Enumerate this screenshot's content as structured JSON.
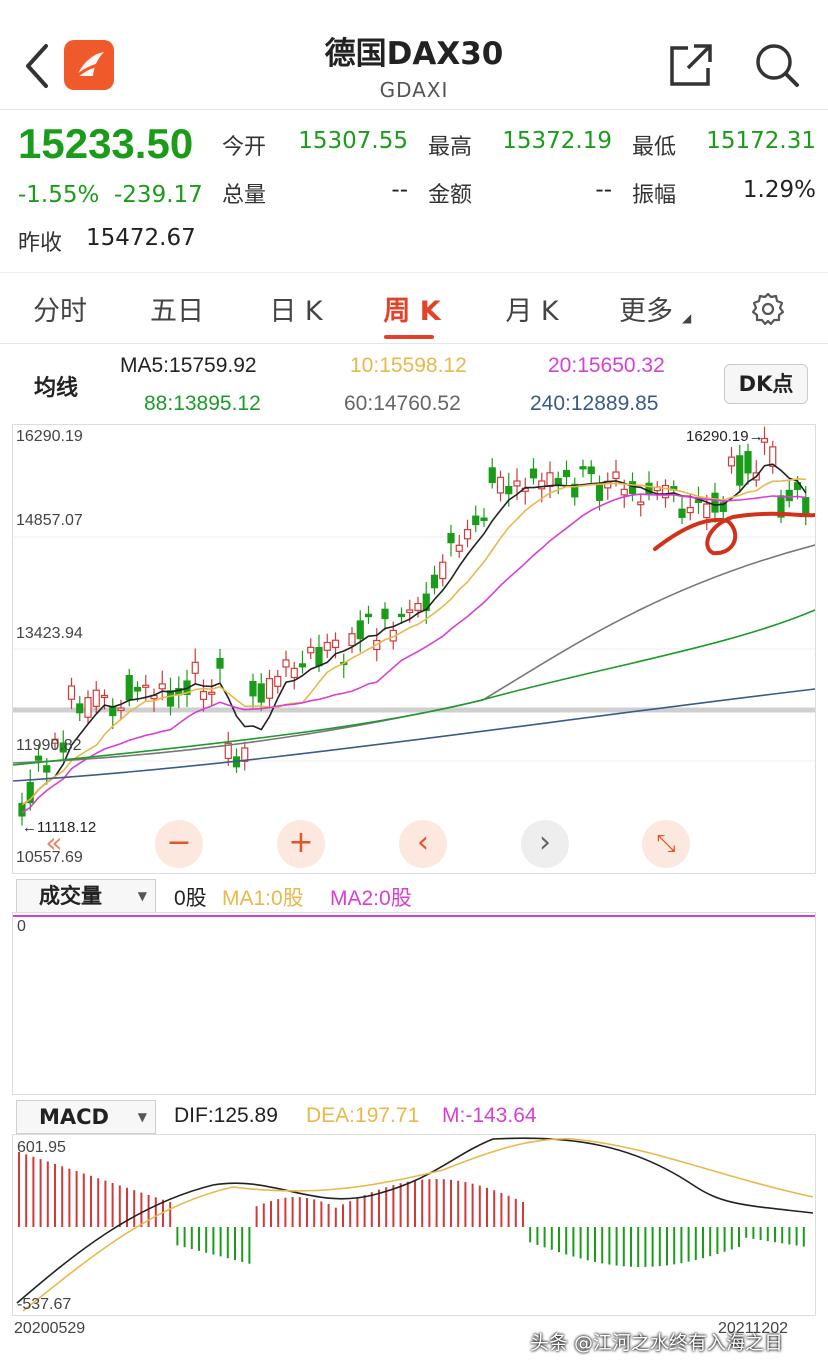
{
  "header": {
    "title": "德国DAX30",
    "subtitle": "GDAXI"
  },
  "quote": {
    "price": "15233.50",
    "change_pct": "-1.55%",
    "change_abs": "-239.17",
    "open_label": "今开",
    "open": "15307.55",
    "high_label": "最高",
    "high": "15372.19",
    "low_label": "最低",
    "low": "15172.31",
    "volume_label": "总量",
    "volume": "--",
    "amount_label": "金额",
    "amount": "--",
    "amplitude_label": "振幅",
    "amplitude": "1.29%",
    "prev_close_label": "昨收",
    "prev_close": "15472.67"
  },
  "tabs": [
    {
      "label": "分时"
    },
    {
      "label": "五日"
    },
    {
      "label": "日 K"
    },
    {
      "label": "周 K"
    },
    {
      "label": "月 K"
    },
    {
      "label": "更多"
    }
  ],
  "active_tab": "周 K",
  "ma_legend": {
    "label": "均线",
    "ma5": "MA5:15759.92",
    "ma10": "10:15598.12",
    "ma20": "20:15650.32",
    "ma88": "88:13895.12",
    "ma60": "60:14760.52",
    "ma240": "240:12889.85",
    "dk_button": "DK点"
  },
  "colors": {
    "up": "#d23a3a",
    "down": "#1a9c1a",
    "ma5": "#222222",
    "ma10": "#e8b84a",
    "ma20": "#d63fd6",
    "ma88": "#1f9a2a",
    "ma60": "#777777",
    "ma240": "#3a5a8a",
    "accent": "#e0432a"
  },
  "price_axis": {
    "top": "16290.19",
    "l2": "14857.07",
    "l3": "13423.94",
    "l4": "11990.82",
    "bottom": "10557.69",
    "max_marker": "16290.19",
    "min_marker": "11118.12"
  },
  "volume": {
    "select_label": "成交量",
    "value": "0股",
    "ma1": "MA1:0股",
    "ma2": "MA2:0股",
    "axis_zero": "0"
  },
  "macd": {
    "select_label": "MACD",
    "dif": "DIF:125.89",
    "dea": "DEA:197.71",
    "m": "M:-143.64",
    "axis_top": "601.95",
    "axis_bottom": "-537.67",
    "date_start": "20200529",
    "date_end": "20211202"
  },
  "controls": {
    "rewind": "«",
    "zoom_out": "−",
    "zoom_in": "+",
    "prev": "‹",
    "next": "›",
    "fullscreen": "⤡"
  },
  "watermark": "头条 @江河之水终有入海之日"
}
